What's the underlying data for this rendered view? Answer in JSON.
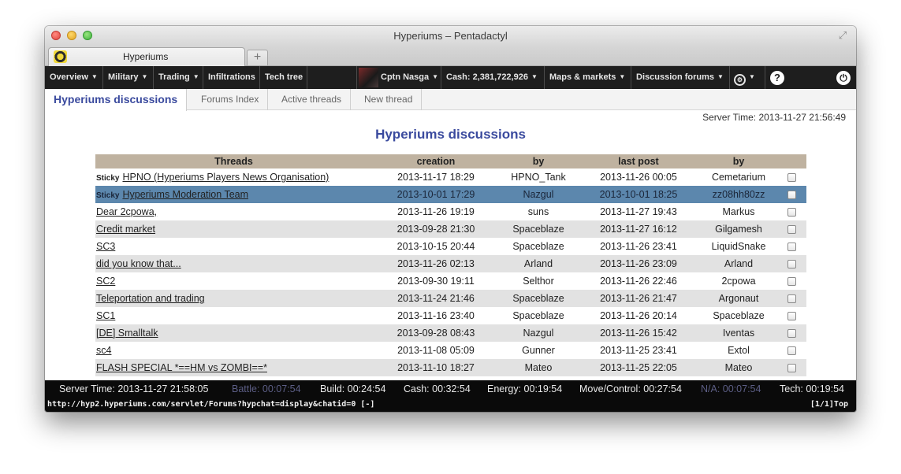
{
  "window": {
    "title": "Hyperiums – Pentadactyl"
  },
  "browser_tab": {
    "label": "Hyperiums",
    "new_tab_label": "+"
  },
  "navbar": {
    "items": [
      {
        "label": "Overview",
        "has_caret": true
      },
      {
        "label": "Military",
        "has_caret": true
      },
      {
        "label": "Trading",
        "has_caret": true
      },
      {
        "label": "Infiltrations",
        "has_caret": false
      },
      {
        "label": "Tech tree",
        "has_caret": false
      }
    ],
    "player": {
      "label": "Cptn Nasga"
    },
    "cash": {
      "label": "Cash: 2,381,722,926"
    },
    "maps": {
      "label": "Maps & markets"
    },
    "forums": {
      "label": "Discussion forums"
    },
    "caret": "▼",
    "settings_glyph": "⚙",
    "help_glyph": "?",
    "power_glyph": "⏻"
  },
  "subtabs": {
    "active": "Hyperiums discussions",
    "items": [
      "Forums Index",
      "Active threads",
      "New thread"
    ]
  },
  "server_time_top": "Server Time: 2013-11-27 21:56:49",
  "page_title": "Hyperiums discussions",
  "table": {
    "headers": [
      "Threads",
      "creation",
      "by",
      "last post",
      "by"
    ],
    "sticky_label": "Sticky",
    "rows": [
      {
        "sticky": true,
        "title": "HPNO (Hyperiums Players News Organisation)",
        "creation": "2013-11-17 18:29",
        "by": "HPNO_Tank",
        "last_post": "2013-11-26 00:05",
        "last_by": "Cemetarium"
      },
      {
        "sticky": true,
        "title": "Hyperiums Moderation Team",
        "creation": "2013-10-01 17:29",
        "by": "Nazgul",
        "last_post": "2013-10-01 18:25",
        "last_by": "zz08hh80zz"
      },
      {
        "sticky": false,
        "title": "Dear 2cpowa,",
        "creation": "2013-11-26 19:19",
        "by": "suns",
        "last_post": "2013-11-27 19:43",
        "last_by": "Markus"
      },
      {
        "sticky": false,
        "title": "Credit market",
        "creation": "2013-09-28 21:30",
        "by": "Spaceblaze",
        "last_post": "2013-11-27 16:12",
        "last_by": "Gilgamesh"
      },
      {
        "sticky": false,
        "title": "SC3",
        "creation": "2013-10-15 20:44",
        "by": "Spaceblaze",
        "last_post": "2013-11-26 23:41",
        "last_by": "LiquidSnake"
      },
      {
        "sticky": false,
        "title": "did you know that...",
        "creation": "2013-11-26 02:13",
        "by": "Arland",
        "last_post": "2013-11-26 23:09",
        "last_by": "Arland"
      },
      {
        "sticky": false,
        "title": "SC2",
        "creation": "2013-09-30 19:11",
        "by": "Selthor",
        "last_post": "2013-11-26 22:46",
        "last_by": "2cpowa"
      },
      {
        "sticky": false,
        "title": "Teleportation and trading",
        "creation": "2013-11-24 21:46",
        "by": "Spaceblaze",
        "last_post": "2013-11-26 21:47",
        "last_by": "Argonaut"
      },
      {
        "sticky": false,
        "title": "SC1",
        "creation": "2013-11-16 23:40",
        "by": "Spaceblaze",
        "last_post": "2013-11-26 20:14",
        "last_by": "Spaceblaze"
      },
      {
        "sticky": false,
        "title": "[DE] Smalltalk",
        "creation": "2013-09-28 08:43",
        "by": "Nazgul",
        "last_post": "2013-11-26 15:42",
        "last_by": "Iventas"
      },
      {
        "sticky": false,
        "title": "sc4",
        "creation": "2013-11-08 05:09",
        "by": "Gunner",
        "last_post": "2013-11-25 23:41",
        "last_by": "Extol"
      },
      {
        "sticky": false,
        "title": "FLASH SPECIAL *==HM vs ZOMBI==*",
        "creation": "2013-11-10 18:27",
        "by": "Mateo",
        "last_post": "2013-11-25 22:05",
        "last_by": "Mateo"
      }
    ]
  },
  "footer": {
    "server_time": "Server Time: 2013-11-27 21:58:05",
    "battle": "Battle: 00:07:54",
    "build": "Build: 00:24:54",
    "cash": "Cash: 00:32:54",
    "energy": "Energy: 00:19:54",
    "move": "Move/Control: 00:27:54",
    "na": "N/A: 00:07:54",
    "tech": "Tech: 00:19:54"
  },
  "statusbar": {
    "url": "http://hyp2.hyperiums.com/servlet/Forums?hypchat=display&chatid=0 [-]",
    "position": "[1/1]Top"
  },
  "colors": {
    "accent": "#3a4a9e",
    "table_header": "#bfb2a0",
    "row_selected": "#5c87ad",
    "row_alt": "#e2e2e2",
    "nav_bg": "#1e1e1e"
  }
}
